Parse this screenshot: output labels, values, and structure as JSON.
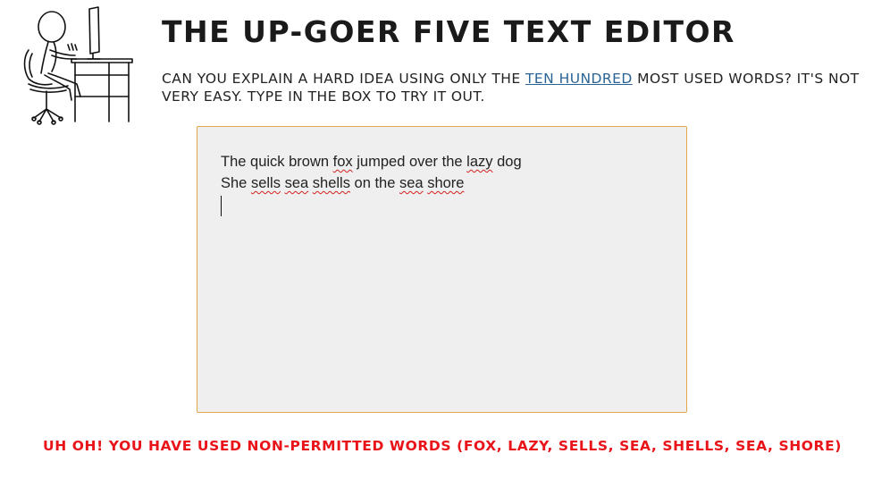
{
  "header": {
    "title": "THE UP-GOER FIVE TEXT EDITOR",
    "intro_before": "CAN YOU EXPLAIN A HARD IDEA USING ONLY THE ",
    "intro_link": "TEN HUNDRED",
    "intro_after": " MOST USED WORDS? IT'S NOT VERY EASY. TYPE IN THE BOX TO TRY IT OUT.",
    "illustration_icon": "stick-figure-at-computer-icon"
  },
  "editor": {
    "lines": [
      [
        {
          "text": "The quick brown ",
          "flagged": false
        },
        {
          "text": "fox",
          "flagged": true
        },
        {
          "text": " jumped over the ",
          "flagged": false
        },
        {
          "text": "lazy",
          "flagged": true
        },
        {
          "text": " dog",
          "flagged": false
        }
      ],
      [
        {
          "text": "She ",
          "flagged": false
        },
        {
          "text": "sells",
          "flagged": true
        },
        {
          "text": " ",
          "flagged": false
        },
        {
          "text": "sea",
          "flagged": true
        },
        {
          "text": " ",
          "flagged": false
        },
        {
          "text": "shells",
          "flagged": true
        },
        {
          "text": " on the ",
          "flagged": false
        },
        {
          "text": "sea",
          "flagged": true
        },
        {
          "text": " ",
          "flagged": false
        },
        {
          "text": "shore",
          "flagged": true
        }
      ]
    ]
  },
  "status": {
    "message": "UH OH! YOU HAVE USED NON-PERMITTED WORDS (FOX, LAZY, SELLS, SEA, SHELLS, SEA, SHORE)"
  },
  "colors": {
    "editor_border": "#e0a84a",
    "editor_background": "#efefef",
    "warning": "#e8141a",
    "link": "#2a6496",
    "spellcheck_underline": "#d32020"
  }
}
